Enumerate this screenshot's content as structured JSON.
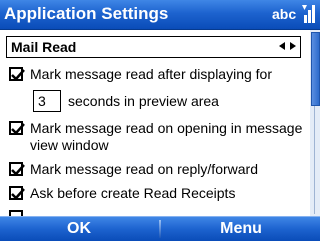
{
  "window": {
    "title": "Application Settings",
    "input_mode": "abc",
    "signal_icon": "signal-strength-icon"
  },
  "dropdown": {
    "value": "Mail Read",
    "left_icon": "arrow-left-icon",
    "right_icon": "arrow-right-icon"
  },
  "options": [
    {
      "label": "Mark message read after displaying for",
      "checked": true
    },
    {
      "label": "Mark message read on opening in message view window",
      "checked": true
    },
    {
      "label": "Mark message read on reply/forward",
      "checked": true
    },
    {
      "label": "Ask before create Read Receipts",
      "checked": true
    }
  ],
  "delay": {
    "value": "3",
    "suffix": "seconds in preview area"
  },
  "softkeys": {
    "left": "OK",
    "right": "Menu"
  },
  "colors": {
    "bar": "#1d63cf",
    "text": "#000000",
    "bar_text": "#ffffff"
  }
}
